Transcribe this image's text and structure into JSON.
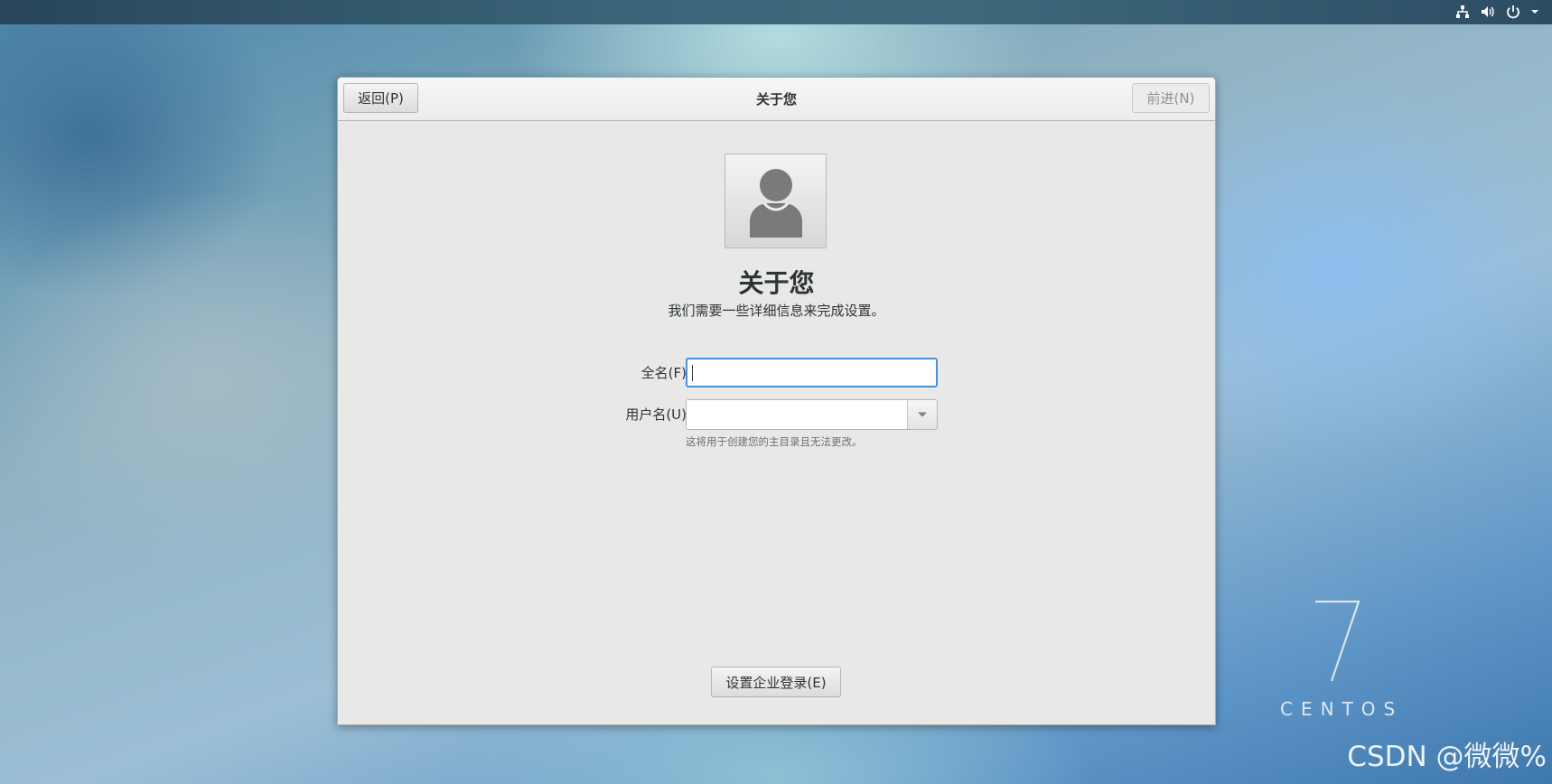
{
  "topbar": {
    "icons": [
      "network-icon",
      "volume-icon",
      "power-icon",
      "chevron-down-icon"
    ]
  },
  "dialog": {
    "header": {
      "back_label": "返回(P)",
      "title": "关于您",
      "next_label": "前进(N)"
    },
    "avatar": {
      "icon": "user-avatar-icon"
    },
    "main_title": "关于您",
    "subtitle": "我们需要一些详细信息来完成设置。",
    "form": {
      "fullname": {
        "label": "全名(F)",
        "value": ""
      },
      "username": {
        "label": "用户名(U)",
        "value": ""
      },
      "hint": "这将用于创建您的主目录且无法更改。"
    },
    "enterprise_button_label": "设置企业登录(E)"
  },
  "desktop": {
    "brand_number": "7",
    "brand_word": "CENTOS",
    "watermark": "CSDN @微微%"
  },
  "colors": {
    "focus_ring": "#4a90d9",
    "dialog_bg": "#e8e8e7",
    "text": "#2e3436"
  }
}
